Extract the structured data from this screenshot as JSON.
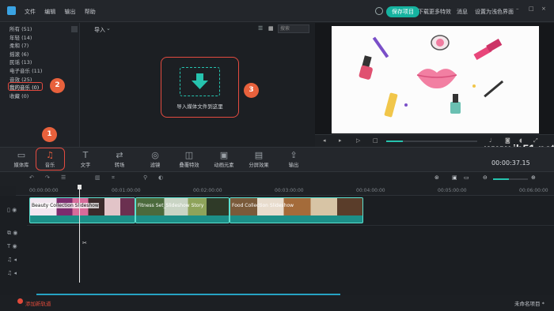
{
  "menu": {
    "file": "文件",
    "edit": "编辑",
    "export": "输出",
    "help": "帮助"
  },
  "header_right": {
    "save": "保存项目",
    "download": "下载更多特效",
    "feedback": "消息",
    "settings": "设置为浅色界面"
  },
  "library": {
    "items": [
      {
        "label": "所有 (51)"
      },
      {
        "label": "年轻 (14)"
      },
      {
        "label": "柔和 (7)"
      },
      {
        "label": "摇滚 (6)"
      },
      {
        "label": "民谣 (13)"
      },
      {
        "label": "电子音乐 (11)"
      },
      {
        "label": "音效 (25)"
      },
      {
        "label": "我的音乐 (0)"
      },
      {
        "label": "收藏 (0)"
      }
    ]
  },
  "media": {
    "import_label": "导入",
    "search_placeholder": "搜索",
    "drop_text": "导入媒体文件到这里"
  },
  "toolbar": {
    "items": [
      {
        "label": "媒体库",
        "icon": "folder-icon"
      },
      {
        "label": "音乐",
        "icon": "music-note-icon"
      },
      {
        "label": "文字",
        "icon": "text-icon"
      },
      {
        "label": "转场",
        "icon": "transition-icon"
      },
      {
        "label": "滤镜",
        "icon": "filter-icon"
      },
      {
        "label": "叠覆特效",
        "icon": "overlay-icon"
      },
      {
        "label": "动画元素",
        "icon": "image-icon"
      },
      {
        "label": "分屏效果",
        "icon": "split-screen-icon"
      },
      {
        "label": "输出",
        "icon": "export-icon"
      }
    ]
  },
  "preview": {
    "timecode": "00:00:37.15"
  },
  "watermark": "www.jb51.net",
  "ruler": {
    "ticks": [
      "00:00:00:00",
      "00:01:00:00",
      "00:02:00:00",
      "00:03:00:00",
      "00:04:00:00",
      "00:05:00:00",
      "00:06:00:00"
    ]
  },
  "clips": [
    {
      "title": "Beauty Collection Slideshow"
    },
    {
      "title": "Fitness Set_Slideshow Story"
    },
    {
      "title": "Food Collection Slideshow"
    }
  ],
  "status": {
    "add_track": "添加新轨道",
    "project_name": "未命名项目 *"
  },
  "callouts": {
    "one": "1",
    "two": "2",
    "three": "3"
  },
  "colors": {
    "accent": "#16b3a0",
    "callout": "#e34b40",
    "badge": "#e8613c"
  }
}
